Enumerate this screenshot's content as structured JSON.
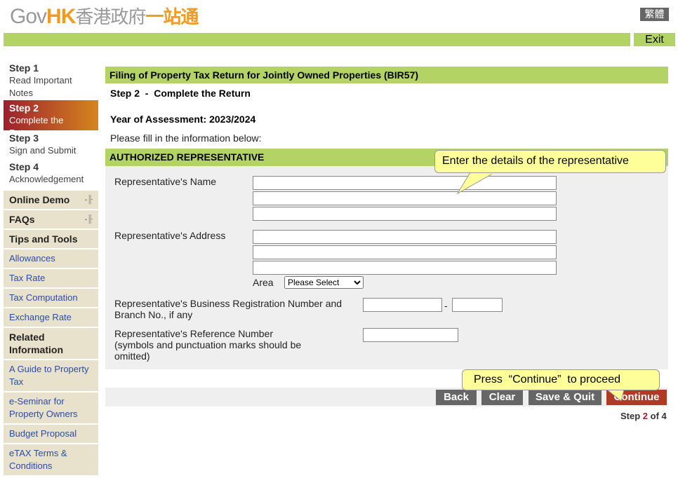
{
  "header": {
    "logo_text_latin": "Gov",
    "logo_text_hk": "HK",
    "logo_text_zh": "香港政府",
    "logo_text_zh2": "一站通",
    "language_label": "繁體",
    "exit_label": "Exit"
  },
  "sidebar": {
    "steps": [
      {
        "title": "Step 1",
        "label": "Read Important Notes"
      },
      {
        "title": "Step 2",
        "label": "Complete the Return",
        "active": true
      },
      {
        "title": "Step 3",
        "label": "Sign and Submit"
      },
      {
        "title": "Step 4",
        "label": "Acknowledgement"
      }
    ],
    "items": [
      {
        "label": "Online Demo",
        "type": "head",
        "arrow": true
      },
      {
        "label": "FAQs",
        "type": "head",
        "arrow": true
      },
      {
        "label": "Tips and Tools",
        "type": "head"
      },
      {
        "label": "Allowances",
        "type": "link"
      },
      {
        "label": "Tax Rate",
        "type": "link"
      },
      {
        "label": "Tax Computation",
        "type": "link"
      },
      {
        "label": "Exchange Rate",
        "type": "link"
      },
      {
        "label": "Related Information",
        "type": "head"
      },
      {
        "label": "A Guide to Property Tax",
        "type": "link"
      },
      {
        "label": "e-Seminar for Property Owners",
        "type": "link"
      },
      {
        "label": "Budget Proposal",
        "type": "link"
      },
      {
        "label": "eTAX Terms & Conditions",
        "type": "link"
      }
    ]
  },
  "main": {
    "title": "Filing of Property Tax Return for Jointly Owned Properties (BIR57)",
    "step_heading": "Step 2  -  Complete the Return",
    "year_of_assessment": "Year of Assessment: 2023/2024",
    "instruction": "Please fill in the information below:",
    "section_title": "AUTHORIZED REPRESENTATIVE",
    "fields": {
      "name_label": "Representative's Name",
      "address_label": "Representative's Address",
      "area_label": "Area",
      "area_selected": "Please Select",
      "brn_label": "Representative's Business Registration Number and Branch No., if any",
      "brn_separator": "-",
      "ref_label": "Representative's Reference Number",
      "ref_note": "(symbols and punctuation marks should be omitted)"
    },
    "buttons": {
      "back": "Back",
      "clear": "Clear",
      "save_quit": "Save & Quit",
      "continue": "Continue"
    },
    "progress_prefix": "Step ",
    "progress_current": "2",
    "progress_suffix": " of 4"
  },
  "callouts": {
    "representative": "Enter the details of the representative",
    "continue": "Press  “Continue”  to proceed"
  },
  "colors": {
    "green": "#b3d465",
    "orange": "#f39a1f",
    "continue_button": "#b03a26",
    "button": "#666666",
    "callout": "#ffff99"
  }
}
